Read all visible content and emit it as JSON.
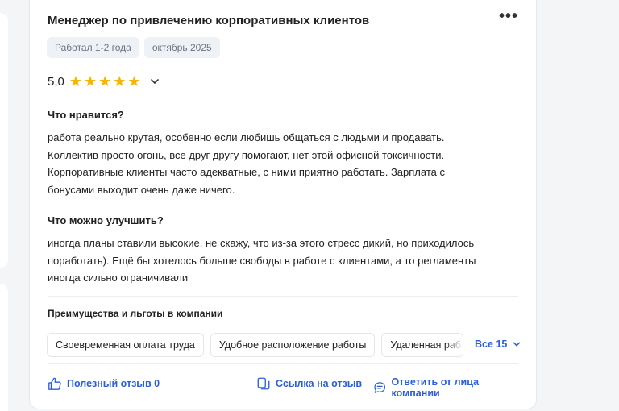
{
  "review": {
    "title": "Менеджер по привлечению корпоративных клиентов",
    "more_label": "•••",
    "tags": [
      "Работал 1-2 года",
      "октябрь 2025"
    ],
    "rating": {
      "value": "5,0",
      "stars": 5
    },
    "likes": {
      "heading": "Что нравится?",
      "lines": [
        "работа реально крутая, особенно если любишь общаться с людьми и продавать.",
        "Коллектив просто огонь, все друг другу помогают, нет этой офисной токсичности.",
        "Корпоративные клиенты часто адекватные, с ними приятно работать. Зарплата с",
        "бонусами выходит очень даже ничего."
      ]
    },
    "improve": {
      "heading": "Что можно улучшить?",
      "lines": [
        "иногда планы ставили высокие, не скажу, что из-за этого стресс дикий, но приходилось",
        "поработать). Ещё бы хотелось больше свободы в работе с клиентами, а то регламенты",
        "иногда сильно ограничивали"
      ]
    },
    "perks": {
      "heading": "Преимущества и льготы в компании",
      "items": [
        "Своевременная оплата труда",
        "Удобное расположение работы",
        "Удаленная работа"
      ],
      "all_label": "Все 15"
    },
    "footer": {
      "helpful_label": "Полезный отзыв 0",
      "link_label": "Ссылка на отзыв",
      "reply_label": "Ответить от лица компании"
    }
  },
  "colors": {
    "accent": "#2b5fd9",
    "star": "#f7b500",
    "tag_bg": "#eef1f5"
  },
  "icons": [
    "more-dots-icon",
    "star-icon",
    "chevron-down-icon",
    "thumbs-up-icon",
    "link-icon",
    "reply-chat-icon"
  ]
}
